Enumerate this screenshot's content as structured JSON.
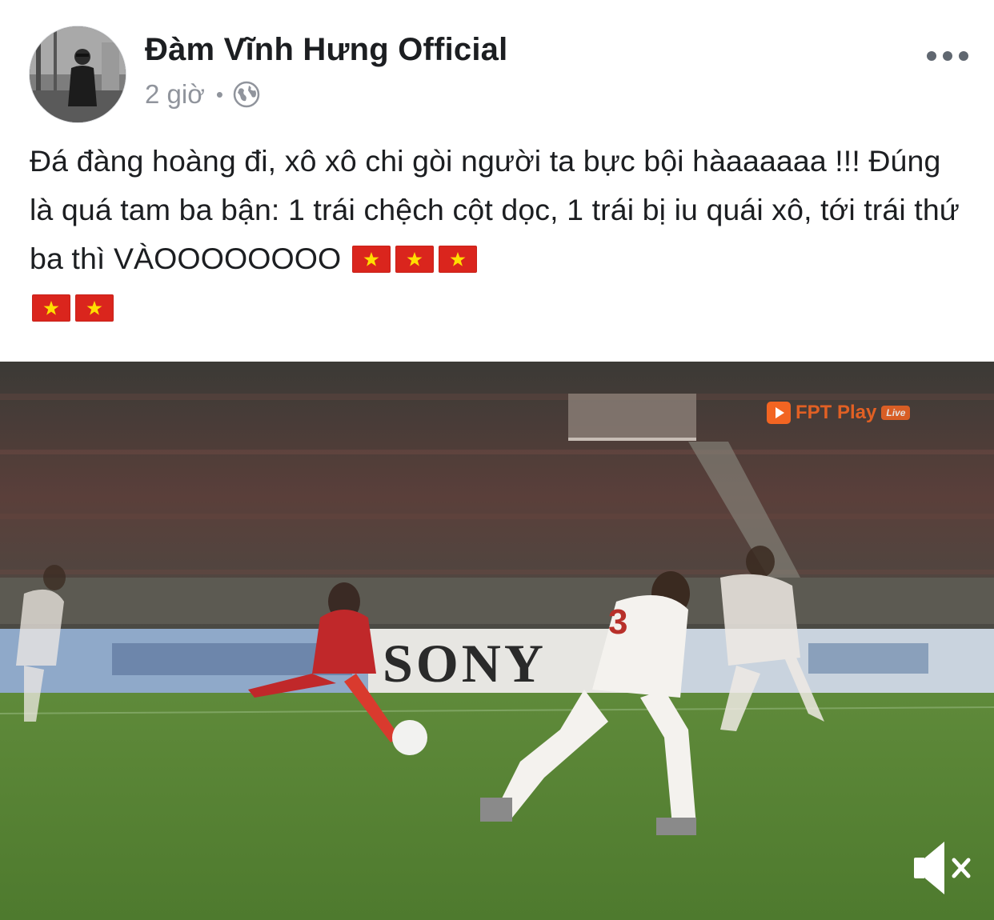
{
  "post": {
    "author": "Đàm Vĩnh Hưng Official",
    "time": "2 giờ",
    "separator": "•",
    "privacy_icon": "globe-icon",
    "more_icon": "more-options-icon",
    "text_main": "Đá đàng hoàng đi, xô xô chi gòi người ta bực bội hàaaaaaa !!! Đúng là quá tam ba bận: 1 trái chệch cột dọc, 1 trái bị iu quái xô, tới trái thứ ba thì VÀOOOOOOOO",
    "flag_count": 5,
    "flag_icon": "vietnam-flag-emoji"
  },
  "video": {
    "watermark_brand": "FPT Play",
    "watermark_live": "Live",
    "billboard_text": "SONY",
    "mute_icon": "volume-muted-icon"
  },
  "colors": {
    "name_text": "#1c1e21",
    "meta_text": "#90949c",
    "flag_red": "#da251d",
    "flag_star": "#ffde00",
    "watermark": "#f26522"
  }
}
